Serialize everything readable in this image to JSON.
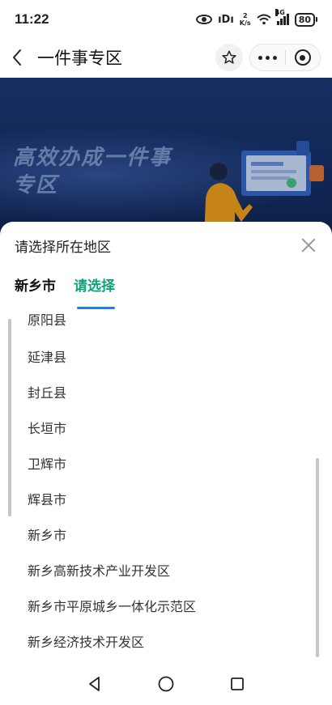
{
  "status": {
    "time": "11:22",
    "speed_top": "2",
    "speed_unit": "K/s",
    "network": "4G",
    "battery": "80"
  },
  "nav": {
    "title": "一件事专区"
  },
  "banner": {
    "line1": "高效办成一件事",
    "line2": "专区"
  },
  "sheet": {
    "title": "请选择所在地区",
    "tabs": [
      {
        "label": "新乡市"
      },
      {
        "label": "请选择"
      }
    ],
    "items": [
      "原阳县",
      "延津县",
      "封丘县",
      "长垣市",
      "卫辉市",
      "辉县市",
      "新乡市",
      "新乡高新技术产业开发区",
      "新乡市平原城乡一体化示范区",
      "新乡经济技术开发区"
    ]
  },
  "colors": {
    "accent": "#10a37a",
    "tab_indicator": "#1e7fe0",
    "banner_bg": "#1a356f"
  }
}
